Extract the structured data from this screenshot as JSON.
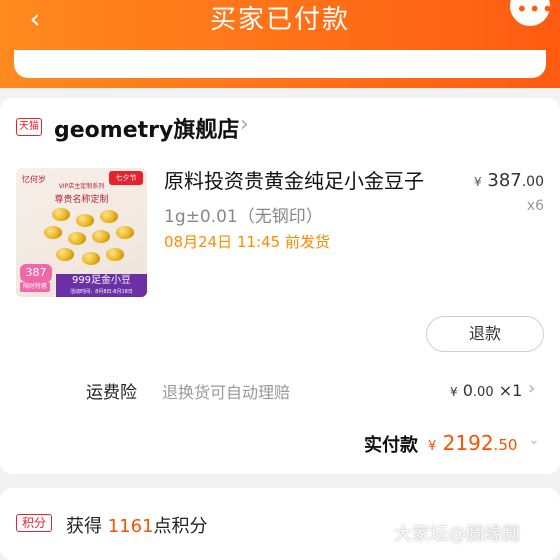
{
  "header": {
    "title": "买家已付款",
    "back_icon": "chevron-left-icon",
    "more_icon": "more-dots-icon",
    "gradient": [
      "#ff8a1f",
      "#ff5b12"
    ]
  },
  "shop": {
    "badge": "天猫",
    "name": "geometry旗舰店"
  },
  "product": {
    "title": "原料投资贵黄金纯足小金豆子",
    "spec": "1g±0.01（无钢印）",
    "ship_time": "08月24日 11:45 前发货",
    "price_symbol": "¥",
    "price_int": "387",
    "price_dec": ".00",
    "quantity": "x6",
    "thumbnail": {
      "brand": "忆何岁",
      "badge": "七夕节",
      "line1": "VIP店主定制系列",
      "line2": "尊贵名称定制",
      "price_tag": "387",
      "subtag": "限时特惠",
      "footer": "999足金小豆",
      "footer_sub": "活动时间：8月8日-8月18日"
    }
  },
  "actions": {
    "refund_label": "退款"
  },
  "insurance": {
    "label": "运费险",
    "desc": "退换货可自动理赔",
    "price_symbol": "¥",
    "price_int": "0",
    "price_dec": ".00",
    "multiplier": "×1"
  },
  "payment": {
    "label": "实付款",
    "symbol": "¥",
    "int": "2192",
    "dec": ".50",
    "accent_color": "#ff5000"
  },
  "points": {
    "tag": "积分",
    "prefix": "获得 ",
    "amount": "1161",
    "suffix": "点积分"
  },
  "watermark": "大家坛@圆缘圆"
}
